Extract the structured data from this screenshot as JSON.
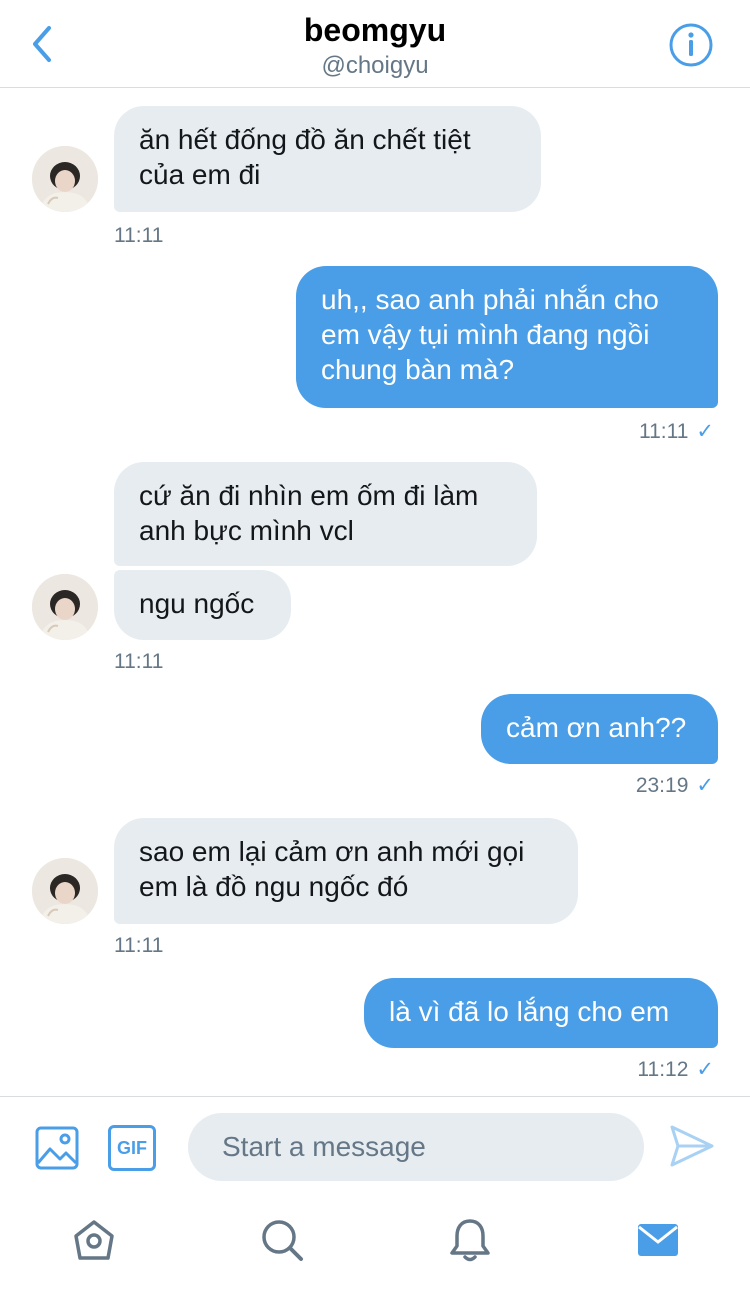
{
  "header": {
    "title": "beomgyu",
    "handle": "@choigyu"
  },
  "messages": [
    {
      "id": 1,
      "direction": "incoming",
      "text_lines": [
        "ăn hết đống đồ ăn chết tiệt",
        "của em đi"
      ]
    },
    {
      "id": 2,
      "direction": "incoming_time",
      "time": "11:11"
    },
    {
      "id": 3,
      "direction": "outgoing",
      "text_lines": [
        "uh,, sao anh phải nhắn cho",
        "em vậy tụi mình đang ngồi",
        "chung bàn mà?"
      ]
    },
    {
      "id": 4,
      "direction": "outgoing_time",
      "time": "11:11",
      "status": "✓"
    },
    {
      "id": 5,
      "direction": "incoming",
      "text_lines": [
        "cứ ăn đi nhìn em ốm đi làm",
        "anh bực mình vcl"
      ]
    },
    {
      "id": 6,
      "direction": "incoming",
      "text_lines": [
        "ngu ngốc"
      ]
    },
    {
      "id": 7,
      "direction": "incoming_time",
      "time": "11:11"
    },
    {
      "id": 8,
      "direction": "outgoing",
      "text_lines": [
        "cảm ơn anh??"
      ]
    },
    {
      "id": 9,
      "direction": "outgoing_time",
      "time": "23:19",
      "status": "✓"
    },
    {
      "id": 10,
      "direction": "incoming",
      "text_lines": [
        "sao em lại cảm ơn anh mới gọi",
        "em là đồ ngu ngốc đó"
      ]
    },
    {
      "id": 11,
      "direction": "incoming_time",
      "time": "11:11"
    },
    {
      "id": 12,
      "direction": "outgoing",
      "text_lines": [
        "là vì đã lo lắng cho em"
      ]
    },
    {
      "id": 13,
      "direction": "outgoing_time",
      "time": "11:12",
      "status": "✓"
    }
  ],
  "composer": {
    "placeholder": "Start a message",
    "gif_label": "GIF"
  },
  "tabs": [
    "home-icon",
    "search-icon",
    "notifications-icon",
    "messages-icon"
  ],
  "colors": {
    "accent": "#4a9ee7",
    "incoming_bubble": "#e6ecf0",
    "muted_text": "#657786"
  }
}
